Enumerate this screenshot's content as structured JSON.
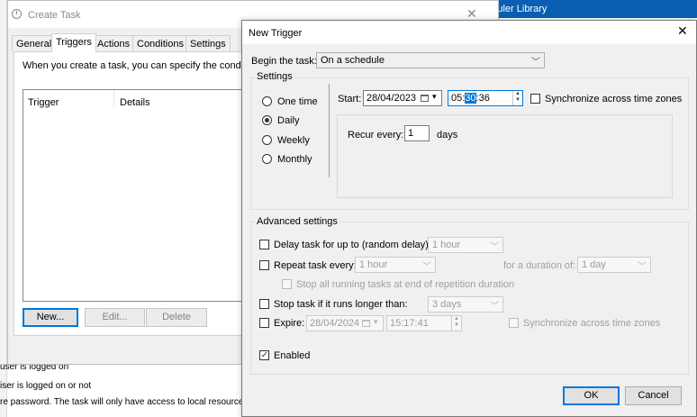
{
  "background": {
    "right_panel_title": "heduler Library",
    "bottom_lines": [
      "user is logged on",
      "iser is logged on or not",
      "re password.  The task will only have access to local resource"
    ]
  },
  "create_task": {
    "title": "Create Task",
    "tabs": [
      {
        "label": "General"
      },
      {
        "label": "Triggers"
      },
      {
        "label": "Actions"
      },
      {
        "label": "Conditions"
      },
      {
        "label": "Settings"
      }
    ],
    "description": "When you create a task, you can specify the conditions",
    "list_headers": [
      "Trigger",
      "Details"
    ],
    "buttons": {
      "new": "New...",
      "edit": "Edit...",
      "delete": "Delete"
    }
  },
  "new_trigger": {
    "title": "New Trigger",
    "begin_label": "Begin the task:",
    "begin_value": "On a schedule",
    "settings_label": "Settings",
    "schedule_options": [
      "One time",
      "Daily",
      "Weekly",
      "Monthly"
    ],
    "selected_schedule": "Daily",
    "start_label": "Start:",
    "start_date": "28/04/2023",
    "start_time_before": "05:",
    "start_time_selected": "30",
    "start_time_after": ":36",
    "sync_label": "Synchronize across time zones",
    "recur_label": "Recur every:",
    "recur_value": "1",
    "recur_unit": "days",
    "advanced_label": "Advanced settings",
    "delay_label": "Delay task for up to (random delay):",
    "delay_value": "1 hour",
    "repeat_label": "Repeat task every:",
    "repeat_value": "1 hour",
    "duration_label": "for a duration of:",
    "duration_value": "1 day",
    "stop_running_label": "Stop all running tasks at end of repetition duration",
    "stop_longer_label": "Stop task if it runs longer than:",
    "stop_longer_value": "3 days",
    "expire_label": "Expire:",
    "expire_date": "28/04/2024",
    "expire_time": "15:17:41",
    "expire_sync_label": "Synchronize across time zones",
    "enabled_label": "Enabled",
    "enabled": true,
    "ok_label": "OK",
    "cancel_label": "Cancel"
  },
  "colors": {
    "accent": "#0078d7",
    "title_bar": "#0a5fb4"
  }
}
